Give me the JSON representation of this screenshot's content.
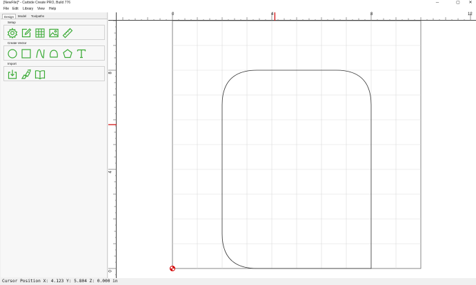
{
  "window": {
    "title": "[NewFile]* - Carbide Create PRO, Build 776",
    "controls": {
      "minimize": "─",
      "maximize": "▢",
      "close": "✕"
    }
  },
  "menu": {
    "items": [
      "File",
      "Edit",
      "Library",
      "View",
      "Help"
    ]
  },
  "panel": {
    "tabs": [
      "Design",
      "Model",
      "Toolpaths"
    ],
    "active_tab": "Design",
    "sections": {
      "setup": {
        "label": "Setup",
        "tools": [
          "job-setup-gear-icon",
          "edit-document-icon",
          "grid-icon",
          "image-icon",
          "measure-ruler-icon"
        ]
      },
      "create_vector": {
        "label": "Create Vector",
        "tools": [
          "circle-icon",
          "rectangle-icon",
          "curve-icon",
          "polygon-blob-icon",
          "pentagon-icon",
          "text-icon"
        ]
      },
      "import": {
        "label": "Import",
        "tools": [
          "import-vector-icon",
          "import-image-icon",
          "library-book-icon"
        ]
      }
    },
    "icon_color": "#3aaa35"
  },
  "canvas": {
    "ruler_units": "in",
    "top_ruler_labels": [
      "0",
      "4",
      "8",
      "12"
    ],
    "left_ruler_labels": [
      "8",
      "4",
      "0"
    ],
    "cursor_indicator_color": "#cc0000",
    "stock": {
      "width_in": 10,
      "height_in": 10
    },
    "grid_spacing_in": 1,
    "shape": {
      "type": "rounded-rectangle",
      "x_range_in": [
        2,
        8
      ],
      "y_range_in": [
        0,
        8
      ],
      "rounded_corners": [
        "top-left",
        "top-right",
        "bottom-left"
      ],
      "corner_radius_in": 1.4
    }
  },
  "status": {
    "text": "Cursor Position X: 4.123 Y: 5.804 Z: 0.000 in"
  }
}
